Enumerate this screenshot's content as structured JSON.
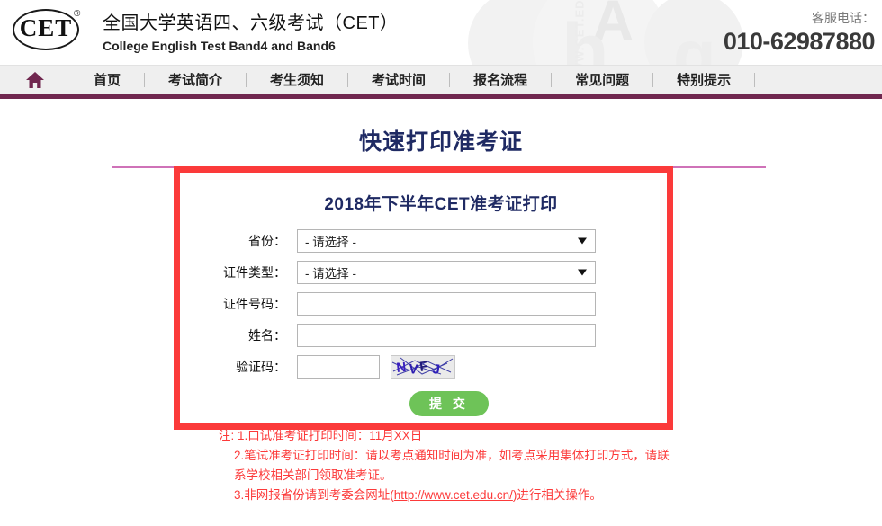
{
  "header": {
    "logo_text": "CET",
    "logo_reg": "®",
    "site_title_cn": "全国大学英语四、六级考试（CET）",
    "site_title_en": "College English Test Band4 and Band6",
    "service_label": "客服电话：",
    "service_phone": "010-62987880",
    "watermark": {
      "letter_a": "A",
      "letter_h": "h",
      "letter_g": "g",
      "side_text": "WWW.CET.EDU.CN"
    }
  },
  "nav": {
    "home_icon": "home-icon",
    "items": [
      {
        "label": "首页"
      },
      {
        "label": "考试简介"
      },
      {
        "label": "考生须知"
      },
      {
        "label": "考试时间"
      },
      {
        "label": "报名流程"
      },
      {
        "label": "常见问题"
      },
      {
        "label": "特别提示"
      }
    ]
  },
  "page": {
    "title": "快速打印准考证"
  },
  "form": {
    "heading": "2018年下半年CET准考证打印",
    "province": {
      "label": "省份：",
      "value": "- 请选择 -"
    },
    "id_type": {
      "label": "证件类型：",
      "value": "- 请选择 -"
    },
    "id_number": {
      "label": "证件号码：",
      "value": "",
      "placeholder": ""
    },
    "name": {
      "label": "姓名：",
      "value": "",
      "placeholder": ""
    },
    "captcha": {
      "label": "验证码：",
      "value": "",
      "placeholder": "",
      "image_text": "NVFJ"
    },
    "submit_label": "提 交"
  },
  "notes": {
    "line1": "注: 1.口试准考证打印时间：11月XX日",
    "line2": "2.笔试准考证打印时间：请以考点通知时间为准，如考点采用集体打印方式，请联",
    "line3": "系学校相关部门领取准考证。",
    "line4_prefix": "3.非网报省份请到考委会网址(",
    "line4_link": "http://www.cet.edu.cn/",
    "line4_suffix": ")进行相关操作。"
  },
  "colors": {
    "nav_purple": "#70274f",
    "title_navy": "#1f2a63",
    "annotation_red": "#fb3a3a",
    "note_red": "#fc3a3a",
    "submit_green": "#6ec358",
    "divider_pink": "#cf72b8"
  }
}
